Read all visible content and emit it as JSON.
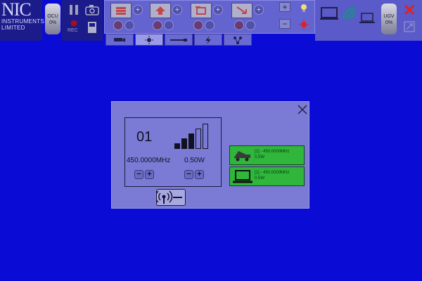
{
  "logo": {
    "line1": "NIC",
    "line2": "INSTRUMENTS",
    "line3": "LIMITED"
  },
  "ocu": {
    "label": "OCU",
    "value": "0%"
  },
  "ugv": {
    "label": "UGV",
    "value": "0%"
  },
  "record": {
    "label": "REC"
  },
  "tabs": [
    "camera",
    "light",
    "gun",
    "laser",
    "network"
  ],
  "dialog": {
    "channel": "01",
    "frequency": "450.0000MHz",
    "power": "0.50W",
    "signal_bars_lit": 3,
    "signal_bars_total": 5,
    "links": [
      {
        "device": "vehicle",
        "line1": "[1] - 450.0000MHz",
        "line2": "0.5W"
      },
      {
        "device": "laptop",
        "line1": "[1] - 450.0000MHz",
        "line2": "0.5W"
      }
    ]
  },
  "colors": {
    "background": "#0b0bd6",
    "panel": "#6464d0",
    "dialog": "#7b7bd6",
    "link_green": "#2fb63b",
    "alert_red": "#e02020"
  }
}
